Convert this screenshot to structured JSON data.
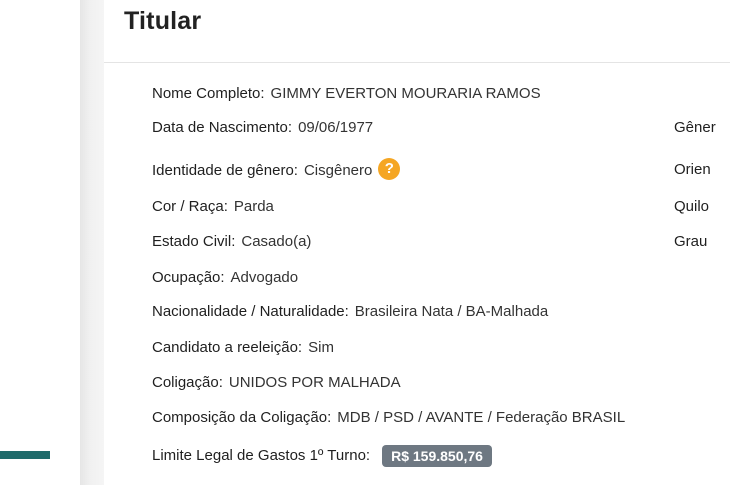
{
  "section": {
    "title": "Titular"
  },
  "fields": {
    "nome_completo": {
      "label": "Nome Completo:",
      "value": "GIMMY EVERTON MOURARIA RAMOS"
    },
    "data_nascimento": {
      "label": "Data de Nascimento:",
      "value": "09/06/1977"
    },
    "identidade_genero": {
      "label": "Identidade de gênero:",
      "value": "Cisgênero",
      "help_icon": "question-mark-icon",
      "help_glyph": "?"
    },
    "cor_raca": {
      "label": "Cor / Raça:",
      "value": "Parda"
    },
    "estado_civil": {
      "label": "Estado Civil:",
      "value": "Casado(a)"
    },
    "ocupacao": {
      "label": "Ocupação:",
      "value": "Advogado"
    },
    "nacionalidade": {
      "label": "Nacionalidade / Naturalidade:",
      "value": "Brasileira Nata / BA-Malhada"
    },
    "candidato_reeleicao": {
      "label": "Candidato a reeleição:",
      "value": "Sim"
    },
    "coligacao": {
      "label": "Coligação:",
      "value": "UNIDOS POR MALHADA"
    },
    "composicao_coligacao": {
      "label": "Composição da Coligação:",
      "value": "MDB / PSD / AVANTE / Federação BRASIL"
    },
    "limite_gastos": {
      "label": "Limite Legal de Gastos 1º Turno:",
      "value": "R$ 159.850,76"
    }
  },
  "side_fields": {
    "genero_label": "Gêner",
    "orientacao_label": "Orien",
    "quilombola_label": "Quilo",
    "grau_label": "Grau"
  },
  "colors": {
    "help_icon": "#f5a623",
    "money_badge": "#6e7882",
    "left_accent": "#1f6b6b"
  }
}
